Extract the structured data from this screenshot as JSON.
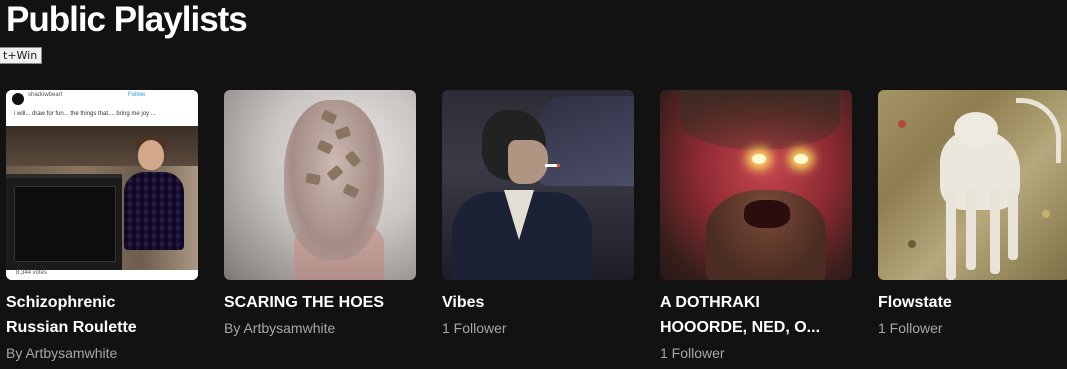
{
  "section": {
    "title": "Public Playlists"
  },
  "tooltip": {
    "text": "t+Win"
  },
  "thumb1": {
    "username": "shadowbeart",
    "follow": "Follow",
    "tweet_text": "i will... draw for fun... the things that.... bring me joy ...",
    "likes": "8,344 votes"
  },
  "playlists": [
    {
      "title_line1": "Schizophrenic",
      "title_line2": "Russian Roulette",
      "subtitle": "By Artbysamwhite"
    },
    {
      "title_line1": "SCARING THE HOES",
      "title_line2": "",
      "subtitle": "By Artbysamwhite"
    },
    {
      "title_line1": "Vibes",
      "title_line2": "",
      "subtitle": "1 Follower"
    },
    {
      "title_line1": "A DOTHRAKI",
      "title_line2": "HOOORDE, NED, O...",
      "subtitle": "1 Follower"
    },
    {
      "title_line1": "Flowstate",
      "title_line2": "",
      "subtitle": "1 Follower"
    }
  ]
}
